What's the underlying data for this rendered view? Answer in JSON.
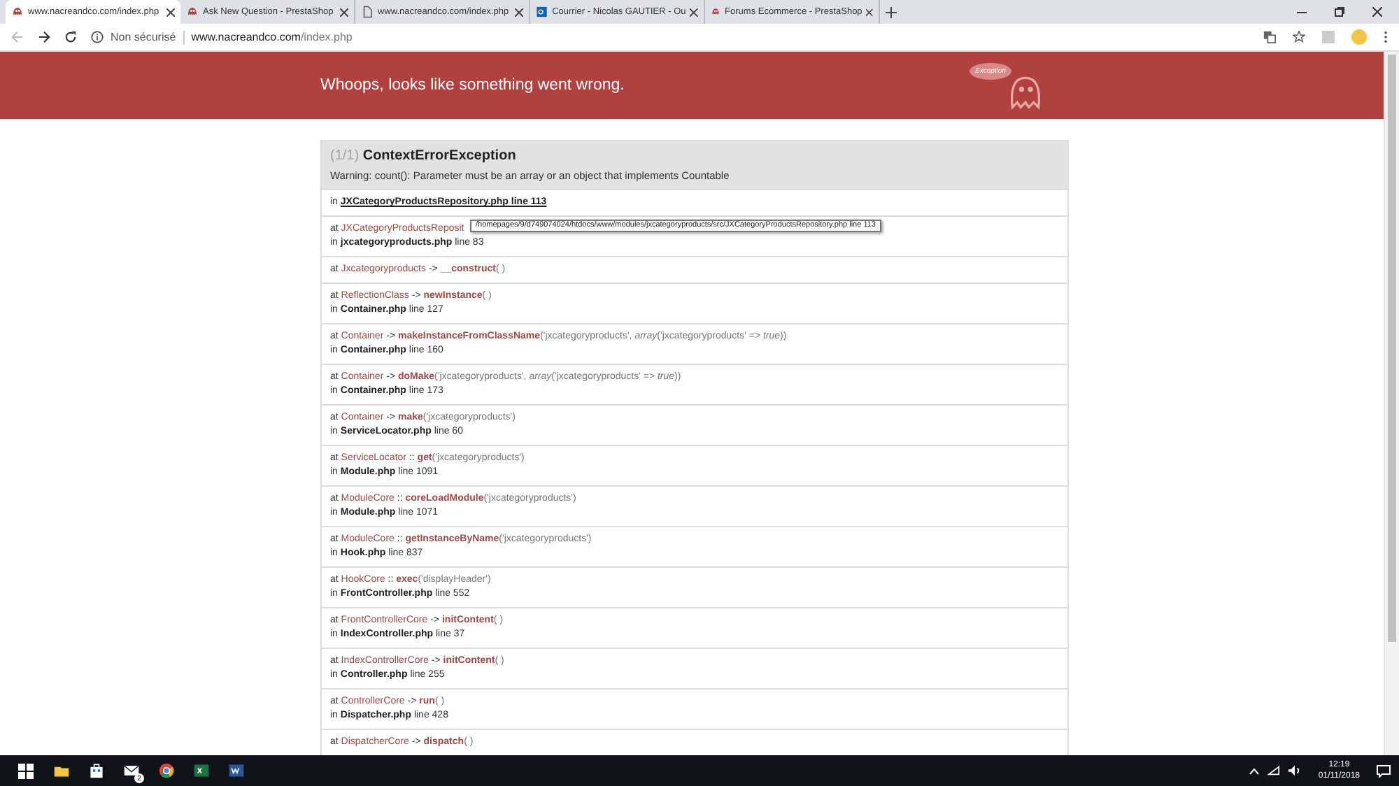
{
  "tabs": [
    {
      "title": "www.nacreandco.com/index.php",
      "kind": "ghost",
      "selected": true
    },
    {
      "title": "Ask New Question - PrestaShop",
      "kind": "ghost",
      "selected": false
    },
    {
      "title": "www.nacreandco.com/index.php",
      "kind": "page",
      "selected": false
    },
    {
      "title": "Courrier - Nicolas GAUTIER - Ou",
      "kind": "outlook",
      "selected": false
    },
    {
      "title": "Forums Ecommerce - PrestaShop",
      "kind": "ghost",
      "selected": false
    }
  ],
  "address_bar": {
    "security": "Non sécurisé",
    "host": "www.nacreandco.com",
    "path": "/index.php"
  },
  "header": {
    "message": "Whoops, looks like something went wrong.",
    "logo_text": "Exception"
  },
  "exception": {
    "count": "(1/1)",
    "name": "ContextErrorException",
    "message": "Warning: count(): Parameter must be an array or an object that implements Countable",
    "location_prefix": "in",
    "location": "JXCategoryProductsRepository.php line 113"
  },
  "trace": [
    {
      "at": "at",
      "class": "JXCategoryProductsReposit",
      "in": "in",
      "file": "jxcategoryproducts.php",
      "line": "line 83",
      "tooltip": "/homepages/9/d749074024/htdocs/www/modules/jxcategoryproducts/src/JXCategoryProductsRepository.php line 113"
    },
    {
      "at": "at",
      "class": "Jxcategoryproducts",
      "sep": "->",
      "method": "__construct",
      "args": "( )"
    },
    {
      "at": "at",
      "class": "ReflectionClass",
      "sep": "->",
      "method": "newInstance",
      "args": "( )",
      "in": "in",
      "file": "Container.php",
      "line": "line 127"
    },
    {
      "at": "at",
      "class": "Container",
      "sep": "->",
      "method": "makeInstanceFromClassName",
      "args": "('jxcategoryproducts', *array*('jxcategoryproducts' => *true*))",
      "in": "in",
      "file": "Container.php",
      "line": "line 160"
    },
    {
      "at": "at",
      "class": "Container",
      "sep": "->",
      "method": "doMake",
      "args": "('jxcategoryproducts', *array*('jxcategoryproducts' => *true*))",
      "in": "in",
      "file": "Container.php",
      "line": "line 173"
    },
    {
      "at": "at",
      "class": "Container",
      "sep": "->",
      "method": "make",
      "args": "('jxcategoryproducts')",
      "in": "in",
      "file": "ServiceLocator.php",
      "line": "line 60"
    },
    {
      "at": "at",
      "class": "ServiceLocator",
      "sep": "::",
      "method": "get",
      "args": "('jxcategoryproducts')",
      "in": "in",
      "file": "Module.php",
      "line": "line 1091"
    },
    {
      "at": "at",
      "class": "ModuleCore",
      "sep": "::",
      "method": "coreLoadModule",
      "args": "('jxcategoryproducts')",
      "in": "in",
      "file": "Module.php",
      "line": "line 1071"
    },
    {
      "at": "at",
      "class": "ModuleCore",
      "sep": "::",
      "method": "getInstanceByName",
      "args": "('jxcategoryproducts')",
      "in": "in",
      "file": "Hook.php",
      "line": "line 837"
    },
    {
      "at": "at",
      "class": "HookCore",
      "sep": "::",
      "method": "exec",
      "args": "('displayHeader')",
      "in": "in",
      "file": "FrontController.php",
      "line": "line 552"
    },
    {
      "at": "at",
      "class": "FrontControllerCore",
      "sep": "->",
      "method": "initContent",
      "args": "( )",
      "in": "in",
      "file": "IndexController.php",
      "line": "line 37"
    },
    {
      "at": "at",
      "class": "IndexControllerCore",
      "sep": "->",
      "method": "initContent",
      "args": "( )",
      "in": "in",
      "file": "Controller.php",
      "line": "line 255"
    },
    {
      "at": "at",
      "class": "ControllerCore",
      "sep": "->",
      "method": "run",
      "args": "( )",
      "in": "in",
      "file": "Dispatcher.php",
      "line": "line 428"
    },
    {
      "at": "at",
      "class": "DispatcherCore",
      "sep": "->",
      "method": "dispatch",
      "args": "( )"
    }
  ],
  "taskbar": {
    "apps": [
      {
        "kind": "explorer"
      },
      {
        "kind": "store"
      },
      {
        "kind": "mail",
        "badge": "2"
      },
      {
        "kind": "chrome"
      },
      {
        "kind": "excel"
      },
      {
        "kind": "word"
      }
    ],
    "time": "12:19",
    "date": "01/11/2018"
  }
}
